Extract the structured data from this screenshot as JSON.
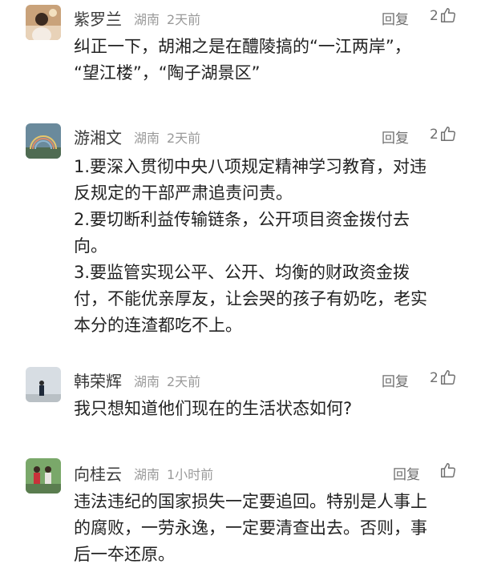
{
  "comments": [
    {
      "name": "紫罗兰",
      "location": "湖南",
      "time": "2天前",
      "reply_label": "回复",
      "likes": "2",
      "avatar_icon": "portrait-photo",
      "lines": [
        "纠正一下，胡湘之是在醴陵搞的“一江两岸”，",
        "“望江楼”，“陶子湖景区”"
      ]
    },
    {
      "name": "游湘文",
      "location": "湖南",
      "time": "2天前",
      "reply_label": "回复",
      "likes": "2",
      "avatar_icon": "rainbow-landscape",
      "lines": [
        "1.要深入贯彻中央八项规定精神学习教育，对违",
        "反规定的干部严肃追责问责。",
        "2.要切断利益传输链条，公开项目资金拨付去",
        "向。",
        "3.要监管实现公平、公开、均衡的财政资金拨",
        "付，不能优亲厚友，让会哭的孩子有奶吃，老实",
        "本分的连渣都吃不上。"
      ]
    },
    {
      "name": "韩荣辉",
      "location": "湖南",
      "time": "2天前",
      "reply_label": "回复",
      "likes": "2",
      "avatar_icon": "person-sky-photo",
      "lines": [
        "我只想知道他们现在的生活状态如何?"
      ]
    },
    {
      "name": "向桂云",
      "location": "湖南",
      "time": "1小时前",
      "reply_label": "回复",
      "likes": "",
      "avatar_icon": "two-people-photo",
      "lines": [
        "违法违纪的国家损失一定要追回。特别是人事上",
        "的腐败，一劳永逸，一定要清查出去。否则，事",
        "后一夲还原。"
      ]
    }
  ],
  "colors": {
    "name": "#3a3a3a",
    "meta": "#9a9a9a",
    "body": "#222222",
    "action": "#6f6f6f"
  }
}
